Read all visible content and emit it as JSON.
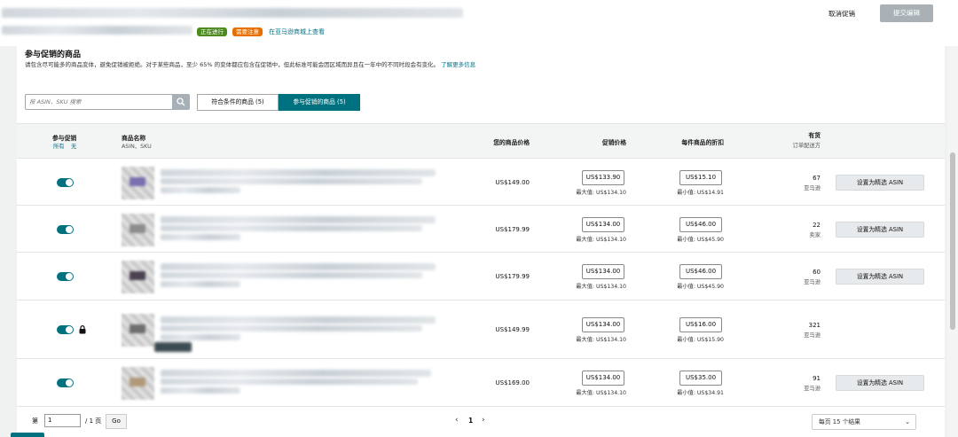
{
  "header": {
    "badge_active": "正在进行",
    "badge_attention": "需要注意",
    "view_link": "在亚马逊商城上查看",
    "cancel_label": "取消促销",
    "submit_label": "提交编辑"
  },
  "section": {
    "title": "参与促销的商品",
    "description": "请包含尽可能多的商品变体，避免促销被拒绝。对于某些商品，至少 65% 的变体都应包含在促销中，但此标准可能会因区域而异且在一年中的不同时段会有变化。",
    "learn_more": "了解更多信息"
  },
  "search": {
    "placeholder": "按 ASIN、SKU 搜索"
  },
  "tabs": [
    {
      "label": "符合条件的商品 (5)"
    },
    {
      "label": "参与促销的商品 (5)"
    }
  ],
  "columns": {
    "participate": "参与促销",
    "participate_all": "所有",
    "participate_none": "无",
    "name": "商品名称",
    "name_sub": "ASIN、SKU",
    "your_price": "您的商品价格",
    "promo_price": "促销价格",
    "unit_discount": "每件商品的折扣",
    "stock": "有货",
    "stock_sub": "订单配送方"
  },
  "colors": {
    "accent": "#00727f",
    "link": "#007185",
    "badge_green": "#4d8a1f",
    "badge_orange": "#e76f00"
  },
  "rows": [
    {
      "your_price": "US$149.00",
      "promo_price": "US$133.90",
      "promo_note": "最大值: US$134.10",
      "discount": "US$15.10",
      "discount_note": "最小值: US$14.91",
      "stock": "67",
      "fulfillment": "亚马逊",
      "button": "设置为精选 ASIN",
      "locked": false,
      "thumb_color": "#7a6fb0"
    },
    {
      "your_price": "US$179.99",
      "promo_price": "US$134.00",
      "promo_note": "最大值: US$134.10",
      "discount": "US$46.00",
      "discount_note": "最小值: US$45.90",
      "stock": "22",
      "fulfillment": "卖家",
      "button": "设置为精选 ASIN",
      "locked": false,
      "thumb_color": "#8d8d8d"
    },
    {
      "your_price": "US$179.99",
      "promo_price": "US$134.00",
      "promo_note": "最大值: US$134.10",
      "discount": "US$46.00",
      "discount_note": "最小值: US$45.90",
      "stock": "60",
      "fulfillment": "亚马逊",
      "button": "设置为精选 ASIN",
      "locked": false,
      "thumb_color": "#4a4250"
    },
    {
      "your_price": "US$149.99",
      "promo_price": "US$134.00",
      "promo_note": "最大值: US$134.10",
      "discount": "US$16.00",
      "discount_note": "最小值: US$15.90",
      "stock": "321",
      "fulfillment": "亚马逊",
      "button": "",
      "locked": true,
      "thumb_color": "#6e6e6e"
    },
    {
      "your_price": "US$169.00",
      "promo_price": "US$134.00",
      "promo_note": "最大值: US$134.10",
      "discount": "US$35.00",
      "discount_note": "最小值: US$34.91",
      "stock": "91",
      "fulfillment": "亚马逊",
      "button": "设置为精选 ASIN",
      "locked": false,
      "thumb_color": "#b09a7a"
    }
  ],
  "pager": {
    "page_prefix": "第",
    "page_value": "1",
    "page_suffix": "/ 1 页",
    "go_label": "Go",
    "current_page": "1",
    "per_page": "每页 15 个结果"
  }
}
